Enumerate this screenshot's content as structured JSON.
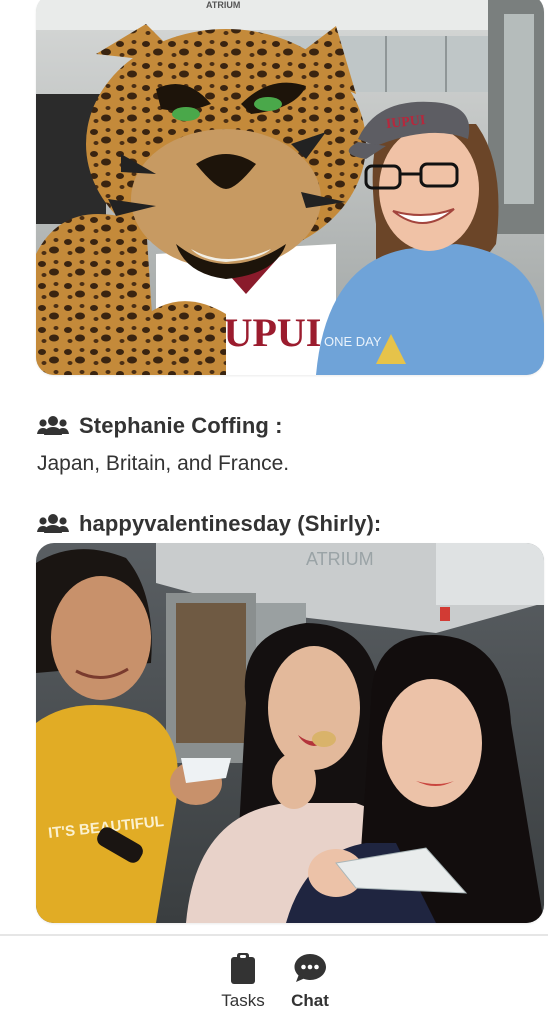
{
  "feed": {
    "posts": [
      {
        "author": "Stephanie Coffing :",
        "message": "Japan, Britain, and France.",
        "icon": "users-icon"
      },
      {
        "author": "happyvalentinesday (Shirly):",
        "icon": "users-icon"
      }
    ],
    "photo1": {
      "sign_text": "ATRIUM",
      "shirt_text": "IUPUI",
      "cap_text": "IUPUI",
      "tee_text": "ONE DAY"
    },
    "photo2": {
      "building_sign": "ATRIUM",
      "shirt_text": "IT'S BEAUTIFUL"
    }
  },
  "bottom_nav": {
    "items": [
      {
        "label": "Tasks",
        "icon": "clipboard-icon",
        "active": false
      },
      {
        "label": "Chat",
        "icon": "chat-bubble-icon",
        "active": true
      }
    ]
  },
  "colors": {
    "text": "#333333",
    "divider": "#e6e6e6",
    "background": "#ffffff"
  }
}
